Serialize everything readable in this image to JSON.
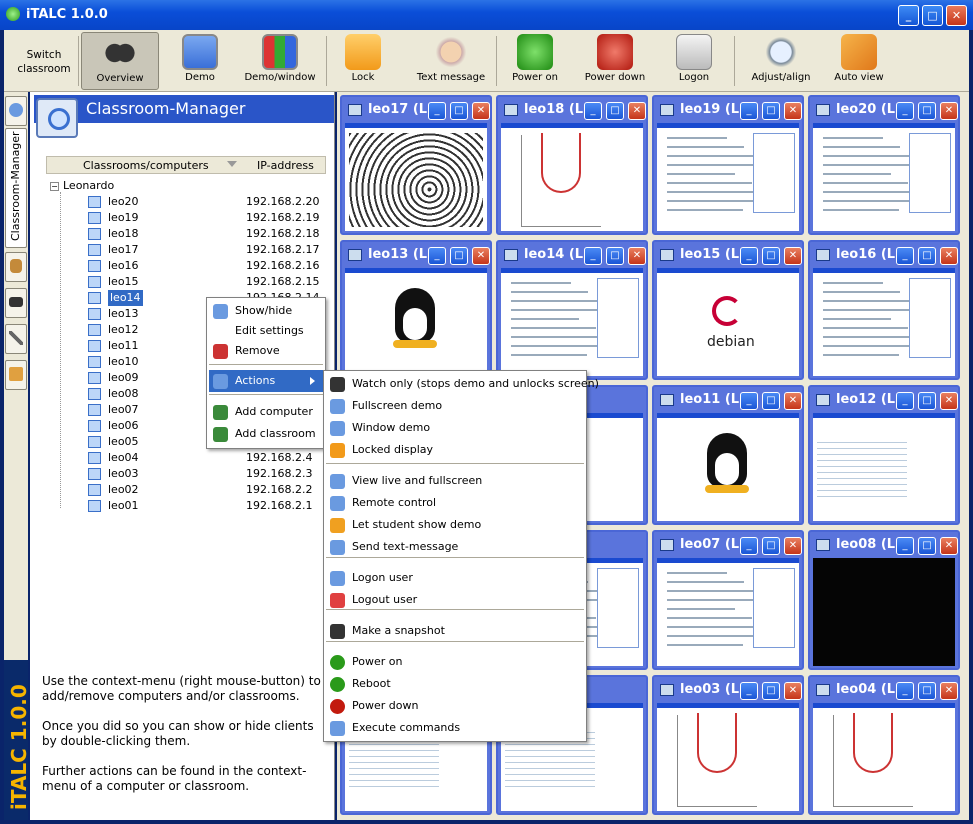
{
  "window": {
    "title": "iTALC 1.0.0",
    "buttons": [
      "_",
      "□",
      "✕"
    ]
  },
  "toolbar": {
    "switch_label": "Switch classroom",
    "buttons": [
      {
        "label": "Overview",
        "icon": "binoculars-icon",
        "active": true
      },
      {
        "label": "Demo",
        "icon": "demo-icon"
      },
      {
        "label": "Demo/window",
        "icon": "demo-window-icon"
      },
      {
        "label": "Lock",
        "icon": "lock-icon"
      },
      {
        "label": "Text message",
        "icon": "text-message-icon"
      },
      {
        "label": "Power on",
        "icon": "power-on-icon"
      },
      {
        "label": "Power down",
        "icon": "power-down-icon"
      },
      {
        "label": "Logon",
        "icon": "logon-icon"
      },
      {
        "label": "Adjust/align",
        "icon": "adjust-align-icon"
      },
      {
        "label": "Auto view",
        "icon": "auto-view-icon"
      }
    ]
  },
  "sidebar": {
    "tab_label": "Classroom-Manager",
    "brand": "iTALC 1.0.0"
  },
  "panel": {
    "title": "Classroom-Manager",
    "col1": "Classrooms/computers",
    "col2": "IP-address",
    "root": "Leonardo",
    "computers": [
      {
        "name": "leo20",
        "ip": "192.168.2.20"
      },
      {
        "name": "leo19",
        "ip": "192.168.2.19"
      },
      {
        "name": "leo18",
        "ip": "192.168.2.18"
      },
      {
        "name": "leo17",
        "ip": "192.168.2.17"
      },
      {
        "name": "leo16",
        "ip": "192.168.2.16"
      },
      {
        "name": "leo15",
        "ip": "192.168.2.15"
      },
      {
        "name": "leo14",
        "ip": "192.168.2.14"
      },
      {
        "name": "leo13",
        "ip": ""
      },
      {
        "name": "leo12",
        "ip": ""
      },
      {
        "name": "leo11",
        "ip": ""
      },
      {
        "name": "leo10",
        "ip": ""
      },
      {
        "name": "leo09",
        "ip": ""
      },
      {
        "name": "leo08",
        "ip": ""
      },
      {
        "name": "leo07",
        "ip": ""
      },
      {
        "name": "leo06",
        "ip": ""
      },
      {
        "name": "leo05",
        "ip": ""
      },
      {
        "name": "leo04",
        "ip": "192.168.2.4"
      },
      {
        "name": "leo03",
        "ip": "192.168.2.3"
      },
      {
        "name": "leo02",
        "ip": "192.168.2.2"
      },
      {
        "name": "leo01",
        "ip": "192.168.2.1"
      }
    ],
    "help1": "Use the context-menu (right mouse-button) to add/remove computers and/or classrooms.",
    "help2": "Once you did so you can show or hide clients by double-clicking them.",
    "help3": "Further actions can be found in the context-menu of a computer or classroom."
  },
  "tiles": [
    {
      "title": "leo17 (L...",
      "kind": "art"
    },
    {
      "title": "leo18 (L...",
      "kind": "plot"
    },
    {
      "title": "leo19 (L...",
      "kind": "code"
    },
    {
      "title": "leo20 (L...",
      "kind": "code"
    },
    {
      "title": "leo13 (L...",
      "kind": "tux"
    },
    {
      "title": "leo14 (L...",
      "kind": "diagram"
    },
    {
      "title": "leo15 (L...",
      "kind": "debian",
      "text": "debian"
    },
    {
      "title": "leo16 (L...",
      "kind": "doc"
    },
    {
      "title": "",
      "kind": "firefox"
    },
    {
      "title": "",
      "kind": "blank"
    },
    {
      "title": "leo11 (L...",
      "kind": "tux"
    },
    {
      "title": "leo12 (L...",
      "kind": "sheet"
    },
    {
      "title": "",
      "kind": "code"
    },
    {
      "title": "",
      "kind": "code"
    },
    {
      "title": "leo07 (L...",
      "kind": "form"
    },
    {
      "title": "leo08 (L...",
      "kind": "black"
    },
    {
      "title": "",
      "kind": "sheet"
    },
    {
      "title": "",
      "kind": "sheet"
    },
    {
      "title": "leo03 (L...",
      "kind": "plot"
    },
    {
      "title": "leo04 (L...",
      "kind": "plot"
    }
  ],
  "context_menu": {
    "items": [
      {
        "label": "Show/hide",
        "icon": "magnifier-icon"
      },
      {
        "label": "Edit settings",
        "icon": ""
      },
      {
        "label": "Remove",
        "icon": "remove-icon"
      },
      {
        "label": "Actions",
        "icon": "monitor-icon",
        "submenu": true
      },
      {
        "label": "Add computer",
        "icon": "add-computer-icon"
      },
      {
        "label": "Add classroom",
        "icon": "add-classroom-icon"
      }
    ]
  },
  "submenu": {
    "items": [
      {
        "label": "Watch only (stops demo and unlocks screen)",
        "icon": "binoculars-icon"
      },
      {
        "label": "Fullscreen demo",
        "icon": "fullscreen-demo-icon"
      },
      {
        "label": "Window demo",
        "icon": "window-demo-icon"
      },
      {
        "label": "Locked display",
        "icon": "lock-icon"
      },
      {
        "label": "View live and fullscreen",
        "icon": "magnifier-icon"
      },
      {
        "label": "Remote control",
        "icon": "remote-control-icon"
      },
      {
        "label": "Let student show demo",
        "icon": "student-demo-icon"
      },
      {
        "label": "Send text-message",
        "icon": "text-message-icon"
      },
      {
        "label": "Logon user",
        "icon": "logon-icon"
      },
      {
        "label": "Logout user",
        "icon": "logout-icon"
      },
      {
        "label": "Make a snapshot",
        "icon": "camera-icon"
      },
      {
        "label": "Power on",
        "icon": "power-on-icon"
      },
      {
        "label": "Reboot",
        "icon": "reboot-icon"
      },
      {
        "label": "Power down",
        "icon": "power-down-icon"
      },
      {
        "label": "Execute commands",
        "icon": "execute-icon"
      }
    ]
  },
  "colors": {
    "titlebar": "#0a4ed8",
    "selection": "#316ac5",
    "tile_border": "#5a74dc",
    "brand": "#f6b400"
  }
}
